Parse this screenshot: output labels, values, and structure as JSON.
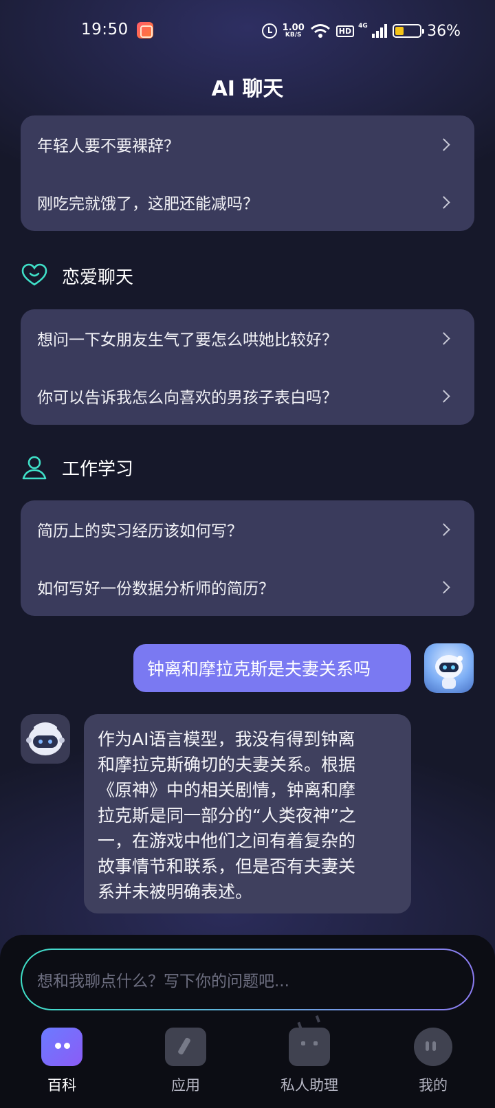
{
  "status_bar": {
    "time": "19:50",
    "net_speed_value": "1.00",
    "net_speed_unit": "KB/S",
    "hd_label": "HD",
    "signal_label": "4G",
    "battery_percent": "36%",
    "battery_level": 0.36,
    "battery_color": "#f5c518"
  },
  "header": {
    "title": "AI 聊天"
  },
  "card_top": {
    "items": [
      {
        "label": "年轻人要不要裸辞？"
      },
      {
        "label": "刚吃完就饿了，这肥还能减吗？"
      }
    ]
  },
  "sections": [
    {
      "title": "恋爱聊天",
      "icon": "heart-chat-icon",
      "items": [
        {
          "label": "想问一下女朋友生气了要怎么哄她比较好？"
        },
        {
          "label": "你可以告诉我怎么向喜欢的男孩子表白吗？"
        }
      ]
    },
    {
      "title": "工作学习",
      "icon": "person-icon",
      "items": [
        {
          "label": "简历上的实习经历该如何写？"
        },
        {
          "label": "如何写好一份数据分析师的简历？"
        }
      ]
    }
  ],
  "chat": {
    "user_message": "钟离和摩拉克斯是夫妻关系吗",
    "bot_reply_lines": [
      "作为AI语言模型，我没有得到钟离",
      "和摩拉克斯确切的夫妻关系。根据",
      "《原神》中的相关剧情，钟离和摩",
      "拉克斯是同一部分的“人类夜神”之",
      "一，在游戏中他们之间有着复杂的",
      "故事情节和联系，但是否有夫妻关",
      "系并未被明确表述。"
    ]
  },
  "input": {
    "placeholder": "想和我聊点什么？写下你的问题吧..."
  },
  "tabs": [
    {
      "label": "百科",
      "icon": "chat-bubble-icon",
      "active": true
    },
    {
      "label": "应用",
      "icon": "pen-icon",
      "active": false
    },
    {
      "label": "私人助理",
      "icon": "robot-icon",
      "active": false
    },
    {
      "label": "我的",
      "icon": "profile-icon",
      "active": false
    }
  ],
  "colors": {
    "accent": "#7a79f2",
    "teal": "#3fe0c8",
    "card_bg": "#3a3b5c",
    "background": "#16182a"
  }
}
